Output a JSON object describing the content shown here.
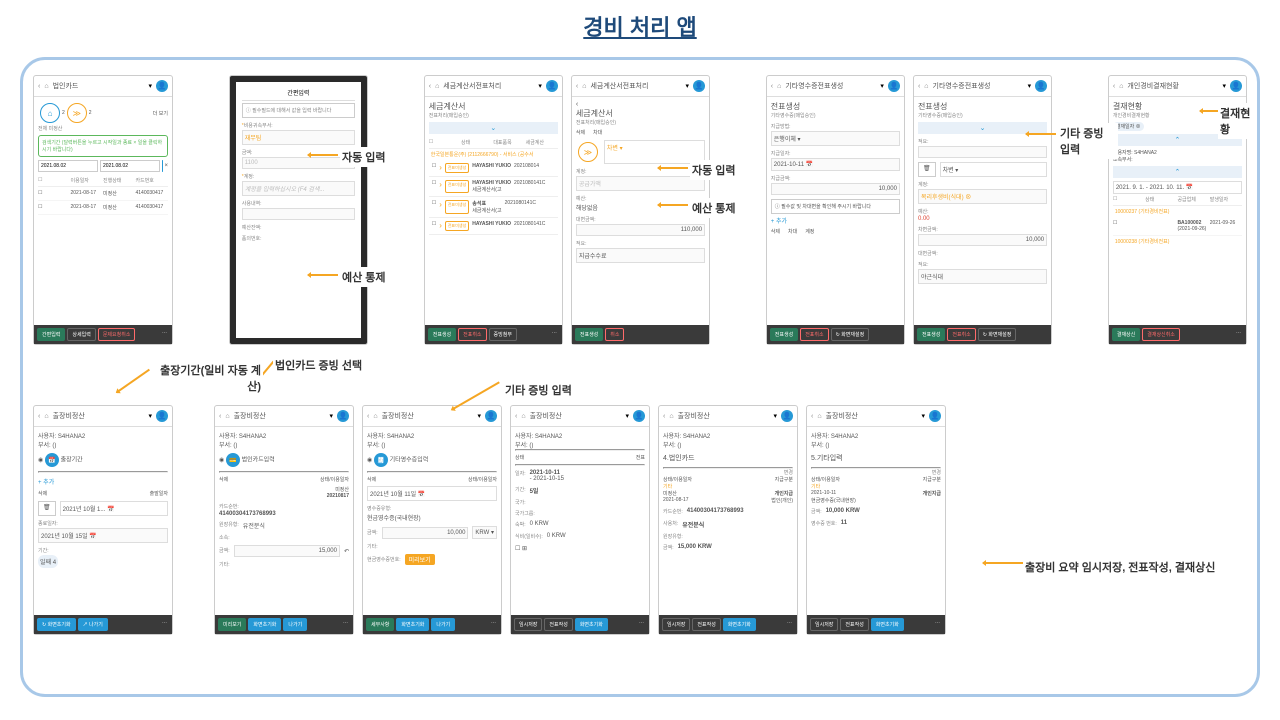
{
  "title": "경비 처리 앱",
  "callouts": {
    "auto_input": "자동 입력",
    "budget_control": "예산 통제",
    "other_evidence_input": "기타 증빙 입력",
    "approval_status": "결재현황",
    "trip_period": "출장기간(일비 자동 계산)",
    "card_select": "법인카드 증빙 선택",
    "other_input": "기타 증빙 입력",
    "trip_summary": "출장비 요약 임시저장, 전표작성, 결재상신"
  },
  "p1": {
    "header": "법인카드",
    "tab1": "전체",
    "tab2": "미정산",
    "more": "더 보기",
    "search_hint": "검색기간 (달력버튼을 누르고 시작일과 종료 × 일을 클릭하시기 바랍니다)",
    "date1": "2021.08.02",
    "date2": "2021.08.02",
    "th1": "이용일자",
    "th2": "진행상태",
    "th3": "카드번호",
    "r1c1": "2021-08-17",
    "r1c2": "미정산",
    "r1c3": "4140030417",
    "r2c1": "2021-08-17",
    "r2c2": "미정산",
    "r2c3": "4140030417",
    "foot1": "간편입력",
    "foot2": "상세입력",
    "foot3": "문제요청취소"
  },
  "p2": {
    "header": "간편입력",
    "hint": "필수필드에 대해서 값을 입력 바랍니다",
    "f1": "비용귀속부서:",
    "f1v": "재무팀",
    "f2": "금액:",
    "f2v": "1100",
    "f3": "계정:",
    "f3p": "계정을 입력하십시오 (F4 검색...",
    "f4": "사용내역:",
    "f5": "예산잔액:",
    "f6": "품의번호:"
  },
  "p3": {
    "header": "세금계산서전표처리",
    "sub": "세금계산서",
    "sub2": "전표처리(매입승인)",
    "th1": "상태",
    "th2": "대표품목",
    "th3": "세금계산",
    "company": "한국일본통운(주) (2112666790) - 서비스 (공수서",
    "badge": "전표미생성",
    "name1": "HAYASHI YUKIO",
    "date1": "202108014",
    "name2": "HAYASHI YUKIO",
    "date2": "2021080141C",
    "name3": "송석표",
    "date3": "2021080141C",
    "name4": "HAYASHI YUKIO",
    "date4": "2021080141C",
    "sub3": "세금계산서(고",
    "sub4": "세금계산서(고",
    "foot1": "전표생성",
    "foot2": "전표취소",
    "foot3": "증빙첨부"
  },
  "p4": {
    "header": "세금계산서전표처리",
    "sub": "세금계산서",
    "sub2": "전표처리(매입승인)",
    "tab1": "삭제",
    "tab2": "차대",
    "f1": "계정:",
    "f1p": "공급가액",
    "f2": "예산:",
    "f2v": "해당없음",
    "f3": "대변금액:",
    "f3v": "110,000",
    "f4": "적요:",
    "f4v": "지급수수료",
    "foot1": "전표생성",
    "foot2": "취소"
  },
  "p5": {
    "header": "기타영수증전표생성",
    "sub": "전표생성",
    "sub2": "기타영수증(매입승인)",
    "f1": "지급방법:",
    "f1v": "은행이체",
    "f2": "지급일자:",
    "f2v": "2021-10-11",
    "f3": "지급금액:",
    "f3v": "10,000",
    "hint": "필수값 및 차대변을 확인해 주시기 바랍니다",
    "add": "추가",
    "tab1": "삭제",
    "tab2": "차대",
    "tab3": "계정",
    "foot1": "전표생성",
    "foot2": "전표취소",
    "foot3": "화면재설정"
  },
  "p6": {
    "header": "기타영수증전표생성",
    "sub": "전표생성",
    "sub2": "기타영수증(매입승인)",
    "f_apply": "적요:",
    "btn_delete": "차변",
    "f1": "계정:",
    "f1v": "복리후생비(식대)",
    "f2": "예산:",
    "f2v": "0.00",
    "f3": "차변금액:",
    "f3v": "10,000",
    "f4": "대변금액:",
    "f5": "적요:",
    "f5v": "야근식대",
    "foot1": "전표생성",
    "foot2": "전표취소",
    "foot3": "화면재설정"
  },
  "p7": {
    "header": "개인경비결재현황",
    "sub": "결재현황",
    "sub2": "개인경비결재현황",
    "tab1": "결재일자",
    "tab2": "더 보기",
    "user": "사용자명: S4HANA2",
    "dept": "소속부서:",
    "date": "2021. 9. 1. - 2021. 10. 11.",
    "th1": "상태",
    "th2": "공급업체",
    "th3": "발생일자",
    "r1": "10000237 (기타경비전표)",
    "r1v1": "BA100002",
    "r1v2": "2021-09-26",
    "r1v3": "(2021-09-26)",
    "r2": "10000238 (기타경비전표)",
    "foot1": "결재상신",
    "foot2": "결재상신취소"
  },
  "b1": {
    "header": "출장비정산",
    "user": "사용자: S4HANA2",
    "dept": "부서: ()",
    "tab": "출장기간",
    "add": "추가",
    "th1": "삭제",
    "th2": "출발일자",
    "date": "2021년 10월 1...",
    "f1": "종료일자:",
    "f1v": "2021년 10월 15일",
    "f2": "기간:",
    "f2v": "일째 4",
    "foot1": "화면초기화",
    "foot2": "나가기"
  },
  "b2": {
    "header": "출장비정산",
    "user": "사용자: S4HANA2",
    "dept": "부서: ()",
    "tab": "법인카드입력",
    "th1": "삭제",
    "th2": "상태/이용일자",
    "f1": "미정산",
    "f1v": "20210817",
    "f2": "카드순번:",
    "f2v": "41400304173768993",
    "f3": "원장유형:",
    "f3v": "유전분식",
    "f4": "소속:",
    "f5": "금액:",
    "f5v": "15,000",
    "f6": "기타:",
    "foot1": "미리보기",
    "foot2": "화면초기화",
    "foot3": "나가기"
  },
  "b3": {
    "header": "출장비정산",
    "user": "사용자: S4HANA2",
    "dept": "부서: ()",
    "tab": "기타영수증입력",
    "th1": "삭제",
    "th2": "상태/이용일자",
    "date": "2021년 10월 11일",
    "f1": "영수증유형:",
    "f1v": "현금영수증(국내현장)",
    "f2": "금액:",
    "f2v": "10,000",
    "f2c": "KRW",
    "f3": "기타:",
    "f4": "현금영수증번호:",
    "btn": "미리보기",
    "foot1": "세부사항",
    "foot2": "화면초기화",
    "foot3": "나가기"
  },
  "b4": {
    "header": "출장비정산",
    "user": "사용자: S4HANA2",
    "dept": "부서: ()",
    "th1": "상태",
    "th2": "전표",
    "f1": "일자:",
    "f1v": "2021-10-11",
    "f1v2": "- 2021-10-15",
    "f2": "기간:",
    "f2v": "5일",
    "f3": "국가:",
    "f4": "국가그룹:",
    "f5": "숙박:",
    "f5v": "0 KRW",
    "f6": "식비(일비수):",
    "f6v": "0 KRW",
    "foot1": "임시저장",
    "foot2": "전표작성",
    "foot3": "화면초기화"
  },
  "b5": {
    "header": "출장비정산",
    "user": "사용자: S4HANA2",
    "dept": "부서: ()",
    "sub": "4.법인카드",
    "btn": "변경",
    "th1": "상태/이용일자",
    "th2": "지급구분",
    "r1": "기타",
    "r2c1": "미정산",
    "r2c2": "개인지급",
    "r3c1": "2021-08-17",
    "r3c2": "법인(개인)",
    "f1": "카드순번:",
    "f1v": "41400304173768993",
    "f2": "사용처:",
    "f2v": "유전분식",
    "f3": "원장유형:",
    "f4": "금액:",
    "f4v": "15,000 KRW",
    "foot1": "임시저장",
    "foot2": "전표작성",
    "foot3": "화면초기화"
  },
  "b6": {
    "header": "출장비정산",
    "user": "사용자: S4HANA2",
    "dept": "부서: ()",
    "sub": "5.기타입력",
    "btn": "변경",
    "th1": "상태/이용일자",
    "th2": "지급구분",
    "r1": "기타",
    "r2c1": "2021-10-11",
    "r2c2": "개인지급",
    "r2c3": "현금영수증(국내현장)",
    "f1": "금액:",
    "f1v": "10,000 KRW",
    "f2": "영수증 번호:",
    "f2v": "11",
    "foot1": "임시저장",
    "foot2": "전표작성",
    "foot3": "화면초기화"
  }
}
